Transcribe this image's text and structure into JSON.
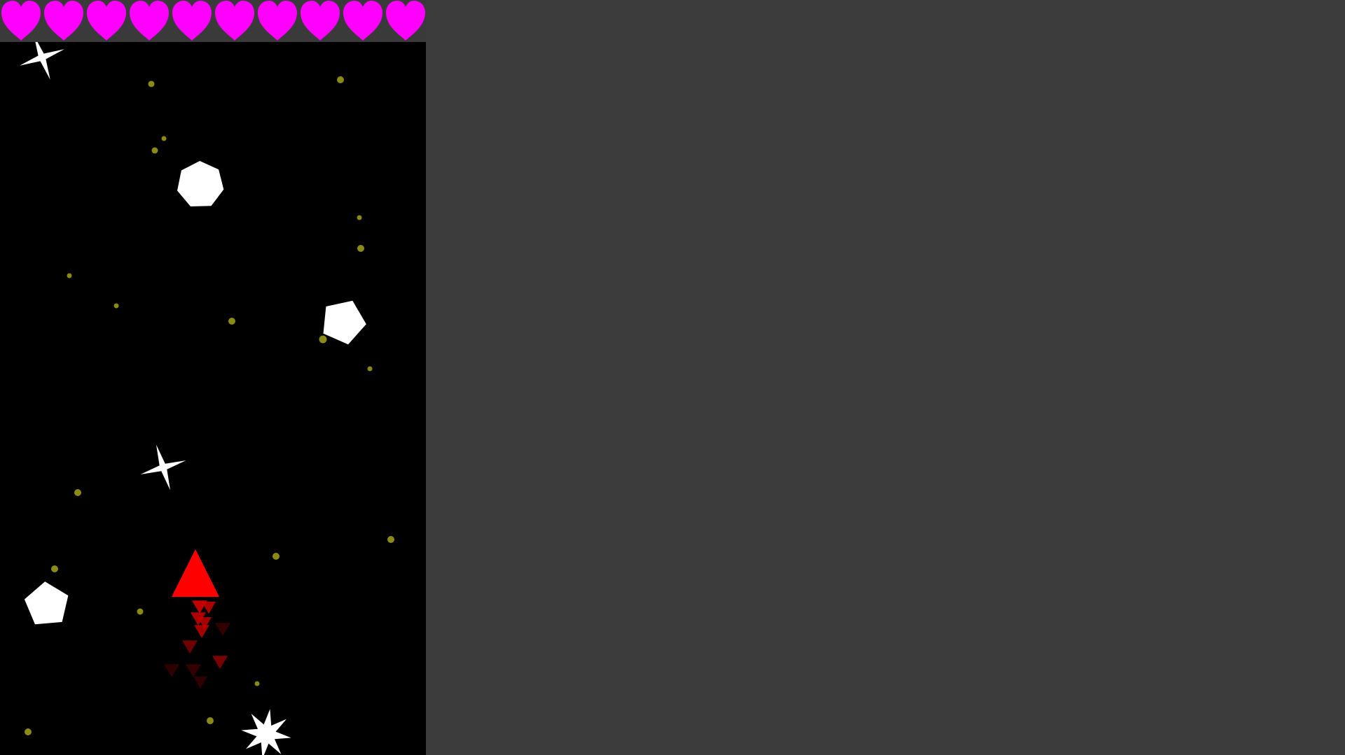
{
  "colors": {
    "background": "#3c3c3c",
    "playfield": "#000000",
    "hud_bar": "#3a3a3a",
    "heart": "#ff00ff",
    "player": "#ff0000",
    "trail_bright": "#cc0000",
    "trail_dark": "#660000",
    "obstacle": "#ffffff",
    "star": "#8a8a14"
  },
  "hud": {
    "lives": 10,
    "life_icon": "heart-icon"
  },
  "player": {
    "icon": "red-triangle-ship-icon",
    "thrust_trail_icon": "red-triangle-exhaust-icon"
  },
  "obstacles": [
    {
      "name": "obstacle-shuriken-1",
      "shape": "four-point-star"
    },
    {
      "name": "obstacle-heptagon",
      "shape": "heptagon"
    },
    {
      "name": "obstacle-pentagon-1",
      "shape": "pentagon"
    },
    {
      "name": "obstacle-shuriken-2",
      "shape": "four-point-star"
    },
    {
      "name": "obstacle-pentagon-2",
      "shape": "pentagon"
    },
    {
      "name": "obstacle-asterisk",
      "shape": "eight-point-star"
    }
  ],
  "background_star_icon": "dot-star-icon"
}
